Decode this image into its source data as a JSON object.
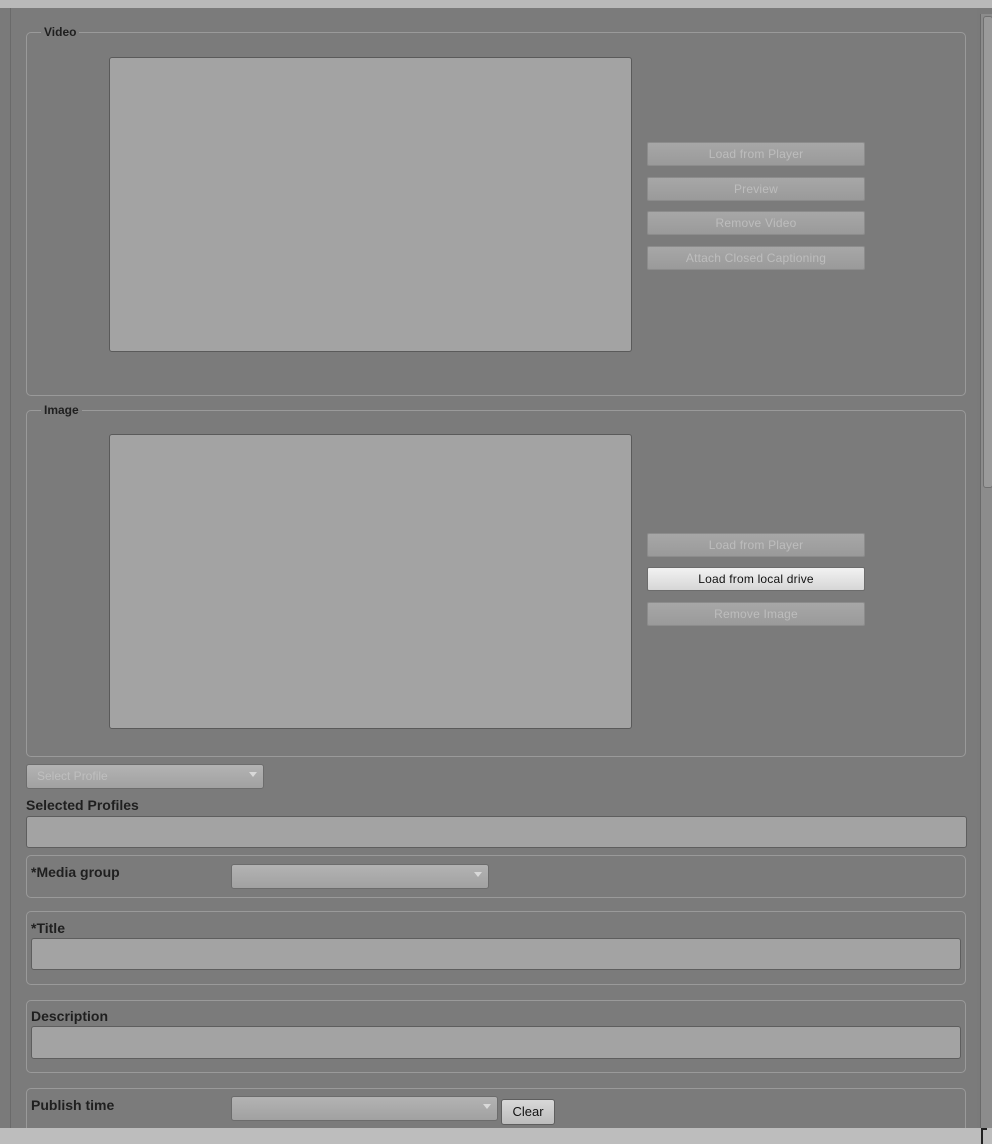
{
  "video": {
    "legend": "Video",
    "buttons": {
      "load_from_player": "Load from Player",
      "preview": "Preview",
      "remove_video": "Remove Video",
      "attach_closed_captioning": "Attach Closed Captioning"
    }
  },
  "image": {
    "legend": "Image",
    "buttons": {
      "load_from_player": "Load from Player",
      "load_from_local_drive": "Load from local drive",
      "remove_image": "Remove Image"
    }
  },
  "profiles": {
    "select_placeholder": "Select Profile",
    "selected_label": "Selected Profiles",
    "selected_value": ""
  },
  "media_group": {
    "label": "*Media group",
    "value": ""
  },
  "title": {
    "label": "*Title",
    "value": ""
  },
  "description": {
    "label": "Description",
    "value": ""
  },
  "publish_time": {
    "label": "Publish time",
    "value": "",
    "clear_label": "Clear"
  },
  "colors": {
    "background": "#7a7a7a",
    "disabled_button_text": "#bdbdbd",
    "active_button_bg": "#e9e9e9",
    "label_text": "#1f1f1f"
  }
}
